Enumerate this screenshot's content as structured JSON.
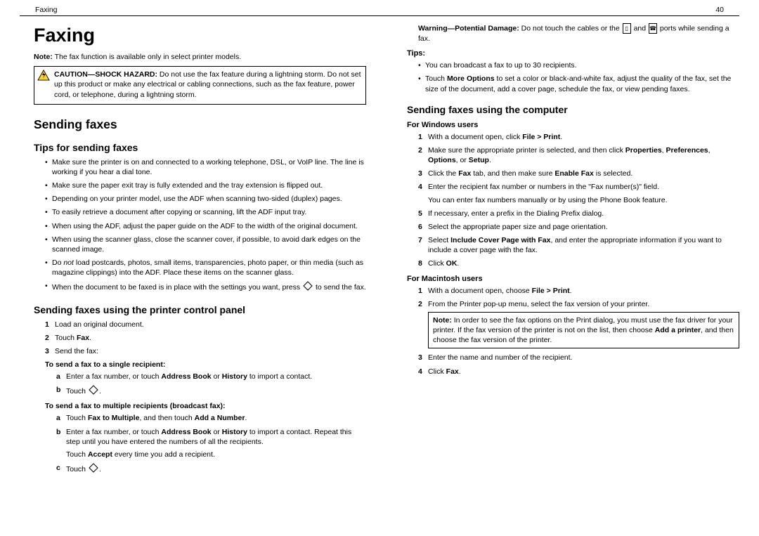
{
  "header": {
    "left": "Faxing",
    "right": "40"
  },
  "left": {
    "h1": "Faxing",
    "note1_label": "Note:",
    "note1_text": " The fax function is available only in select printer models.",
    "caution_label": "CAUTION—SHOCK HAZARD:",
    "caution_text": " Do not use the fax feature during a lightning storm. Do not set up this product or make any electrical or cabling connections, such as the fax feature, power cord, or telephone, during a lightning storm.",
    "h2": "Sending faxes",
    "h3a": "Tips for sending faxes",
    "tips": [
      "Make sure the printer is on and connected to a working telephone, DSL, or VoIP line. The line is working if you hear a dial tone.",
      "Make sure the paper exit tray is fully extended and the tray extension is flipped out.",
      "Depending on your printer model, use the ADF when scanning two-sided (duplex) pages.",
      "To easily retrieve a document after copying or scanning, lift the ADF input tray.",
      "When using the ADF, adjust the paper guide on the ADF to the width of the original document.",
      "When using the scanner glass, close the scanner cover, if possible, to avoid dark edges on the scanned image."
    ],
    "tip_not_pre": "Do ",
    "tip_not_em": "not",
    "tip_not_post": " load postcards, photos, small items, transparencies, photo paper, or thin media (such as magazine clippings) into the ADF. Place these items on the scanner glass.",
    "tip_press_pre": "When the document to be faxed is in place with the settings you want, press ",
    "tip_press_post": " to send the fax.",
    "h3b": "Sending faxes using the printer control panel",
    "step1": "Load an original document.",
    "step2_pre": "Touch ",
    "step2_b": "Fax",
    "step3": "Send the fax:",
    "single_title": "To send a fax to a single recipient:",
    "a_pre": "Enter a fax number, or touch ",
    "a_b1": "Address Book",
    "a_mid": " or ",
    "a_b2": "History",
    "a_post": " to import a contact.",
    "b_touch": "Touch ",
    "multi_title": "To send a fax to multiple recipients (broadcast fax):",
    "ma_pre": "Touch ",
    "ma_b1": "Fax to Multiple",
    "ma_mid": ", and then touch ",
    "ma_b2": "Add a Number",
    "mb_pre": "Enter a fax number, or touch ",
    "mb_b1": "Address Book",
    "mb_mid": " or ",
    "mb_b2": "History",
    "mb_post": " to import a contact. Repeat this step until you have entered the numbers of all the recipients.",
    "mb_line2_pre": "Touch ",
    "mb_line2_b": "Accept",
    "mb_line2_post": " every time you add a recipient.",
    "mc_touch": "Touch "
  },
  "right": {
    "warn_label": "Warning—Potential Damage:",
    "warn_pre": " Do not touch the cables or the ",
    "warn_mid": " and ",
    "warn_post": " ports while sending a fax.",
    "tips_label": "Tips:",
    "tips1": "You can broadcast a fax to up to 30 recipients.",
    "tips2_pre": "Touch ",
    "tips2_b": "More Options",
    "tips2_post": " to set a color or black-and-white fax, adjust the quality of the fax, set the size of the document, add a cover page, schedule the fax, or view pending faxes.",
    "h3c": "Sending faxes using the computer",
    "win_title": "For Windows users",
    "w1_pre": "With a document open, click ",
    "w1_b": "File > Print",
    "w2_pre": "Make sure the appropriate printer is selected, and then click ",
    "w2_b1": "Properties",
    "w2_s1": ", ",
    "w2_b2": "Preferences",
    "w2_s2": ", ",
    "w2_b3": "Options",
    "w2_s3": ", or ",
    "w2_b4": "Setup",
    "w3_pre": "Click the ",
    "w3_b1": "Fax",
    "w3_mid": " tab, and then make sure ",
    "w3_b2": "Enable Fax",
    "w3_post": " is selected.",
    "w4": "Enter the recipient fax number or numbers in the \"Fax number(s)\" field.",
    "w4b": "You can enter fax numbers manually or by using the Phone Book feature.",
    "w5": "If necessary, enter a prefix in the Dialing Prefix dialog.",
    "w6": "Select the appropriate paper size and page orientation.",
    "w7_pre": "Select ",
    "w7_b": "Include Cover Page with Fax",
    "w7_post": ", and enter the appropriate information if you want to include a cover page with the fax.",
    "w8_pre": "Click ",
    "w8_b": "OK",
    "mac_title": "For Macintosh users",
    "m1_pre": "With a document open, choose ",
    "m1_b": "File > Print",
    "m2": "From the Printer pop-up menu, select the fax version of your printer.",
    "m2note_label": "Note:",
    "m2note_pre": " In order to see the fax options on the Print dialog, you must use the fax driver for your printer. If the fax version of the printer is not on the list, then choose ",
    "m2note_b": "Add a printer",
    "m2note_post": ", and then choose the fax version of the printer.",
    "m3": "Enter the name and number of the recipient.",
    "m4_pre": "Click ",
    "m4_b": "Fax"
  }
}
